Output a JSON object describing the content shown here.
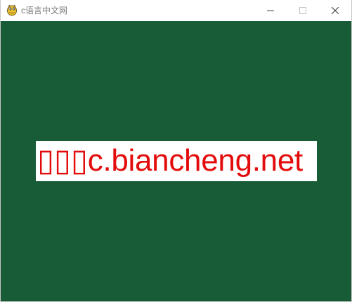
{
  "window": {
    "title": "c语言中文网",
    "app_icon": "python-snake-icon",
    "controls": {
      "minimize_icon": "minimize-icon",
      "maximize_icon": "maximize-icon",
      "close_icon": "close-icon"
    }
  },
  "canvas": {
    "background_color": "#175c36",
    "label": {
      "text": "▯▯▯c.biancheng.net",
      "text_color": "#e30b0b",
      "background_color": "#ffffff"
    }
  }
}
